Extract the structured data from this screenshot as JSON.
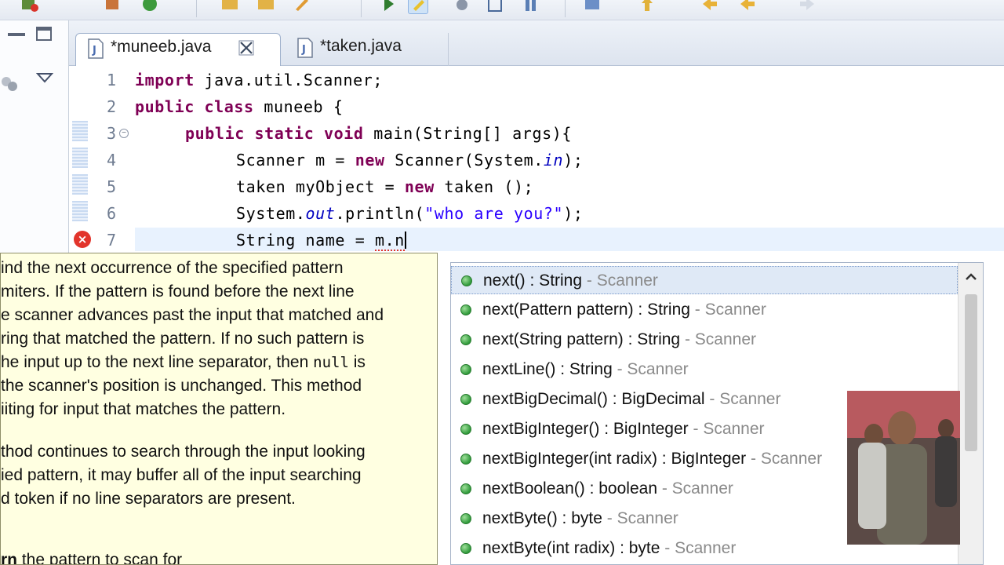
{
  "editor": {
    "tabs": [
      {
        "label": "*muneeb.java"
      },
      {
        "label": "*taken.java"
      }
    ],
    "line_numbers": [
      "1",
      "2",
      "3",
      "4",
      "5",
      "6",
      "7"
    ],
    "code": {
      "l1_kw": "import",
      "l1_rest": " java.util.Scanner;",
      "l2_kw": "public class",
      "l2_rest": " muneeb {",
      "l3_kw": "public static void",
      "l3_rest": " main(String[] args){",
      "l4_a": "Scanner m = ",
      "l4_kw": "new",
      "l4_b": " Scanner(System.",
      "l4_fld": "in",
      "l4_c": ");",
      "l5_a": "taken myObject = ",
      "l5_kw": "new",
      "l5_b": " taken ();",
      "l6_a": "System.",
      "l6_fld": "out",
      "l6_b": ".println(",
      "l6_str": "\"who are you?\"",
      "l6_c": ");",
      "l7_a": "String name = ",
      "l7_err": "m.n"
    }
  },
  "javadoc": {
    "lines": [
      "ind the next occurrence of the specified pattern",
      "miters. If the pattern is found before the next line",
      "e scanner advances past the input that matched and",
      "ring that matched the pattern. If no such pattern is",
      "he input up to the next line separator, then",
      "the scanner's position is unchanged. This method",
      "iiting for input that matches the pattern.",
      "thod continues to search through the input looking",
      "ied pattern, it may buffer all of the input searching",
      "d token if no line separators are present.",
      "the pattern to scan for"
    ],
    "code_null": "null",
    "line5_tail": " is",
    "param_name": "rn"
  },
  "proposals": [
    {
      "name": "next() : String",
      "owner": " - Scanner"
    },
    {
      "name": "next(Pattern pattern) : String",
      "owner": " - Scanner"
    },
    {
      "name": "next(String pattern) : String",
      "owner": " - Scanner"
    },
    {
      "name": "nextLine() : String",
      "owner": " - Scanner"
    },
    {
      "name": "nextBigDecimal() : BigDecimal",
      "owner": " - Scanner"
    },
    {
      "name": "nextBigInteger() : BigInteger",
      "owner": " - Scanner"
    },
    {
      "name": "nextBigInteger(int radix) : BigInteger",
      "owner": " - Scanner"
    },
    {
      "name": "nextBoolean() : boolean",
      "owner": " - Scanner"
    },
    {
      "name": "nextByte() : byte",
      "owner": " - Scanner"
    },
    {
      "name": "nextByte(int radix) : byte",
      "owner": " - Scanner"
    }
  ],
  "icons": {
    "tab_file": "java-file-icon",
    "tab_close": "close-icon",
    "error_marker": "error-icon",
    "proposal": "public-method-icon"
  },
  "colors": {
    "keyword": "#7f0055",
    "string": "#2a00ff",
    "field": "#0000c0",
    "doc_background": "#ffffe1"
  }
}
